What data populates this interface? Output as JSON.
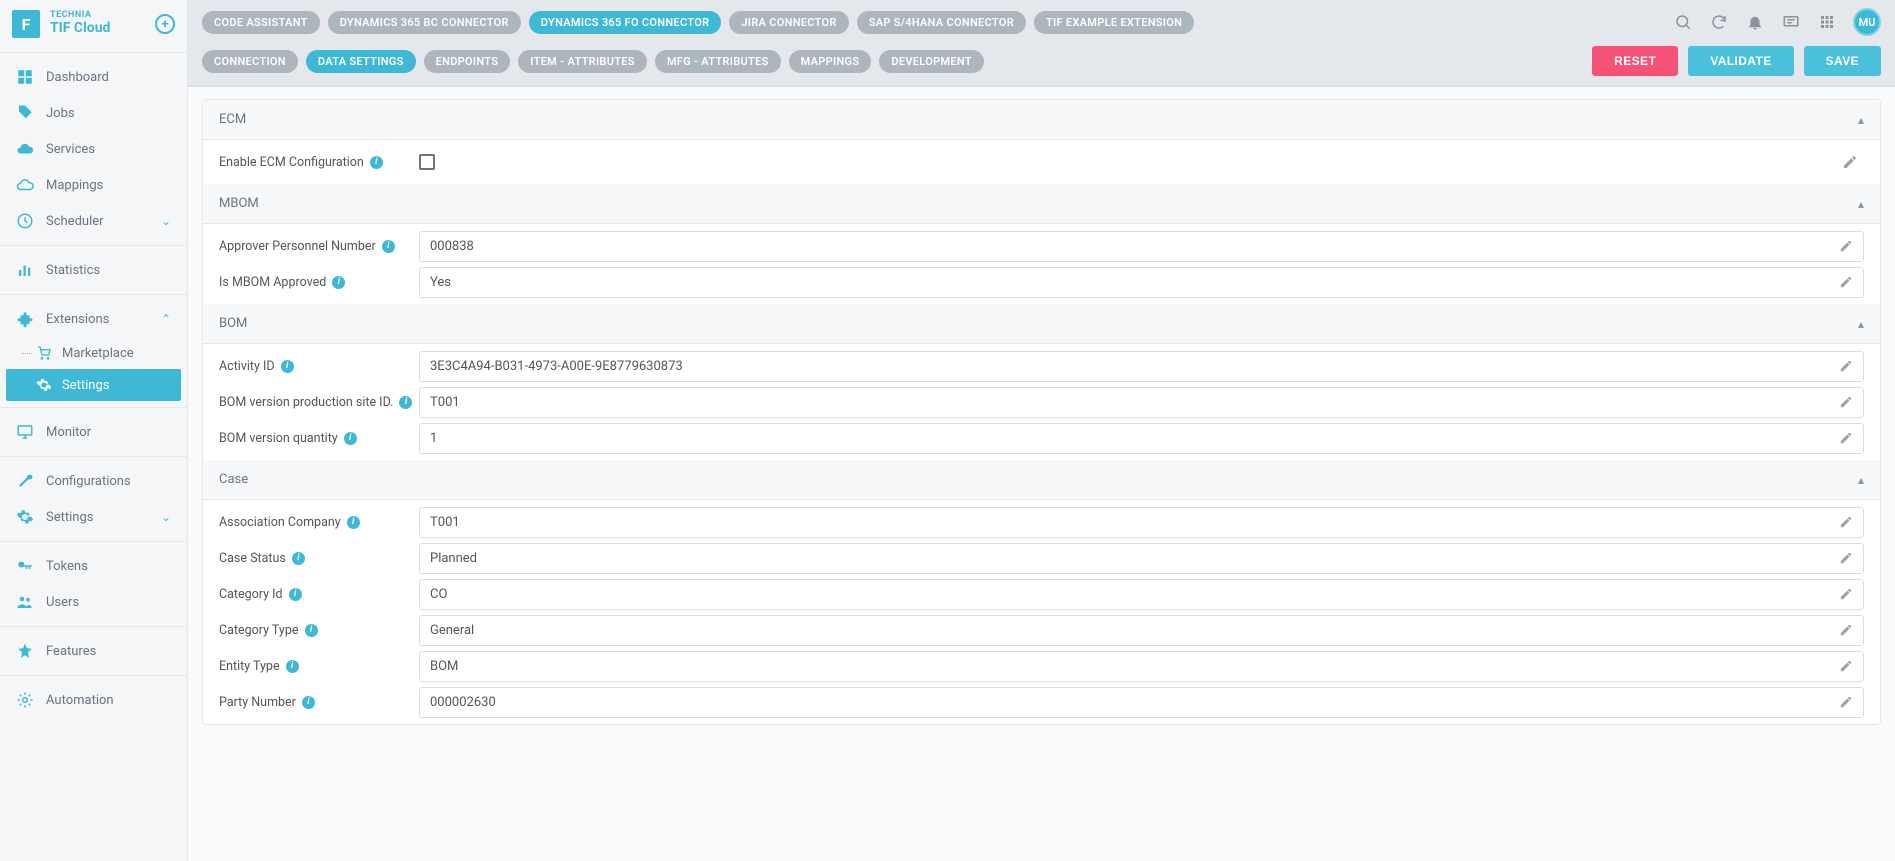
{
  "brand": {
    "company": "TECHNIA",
    "product": "TIF Cloud",
    "logo_letter": "F"
  },
  "user": {
    "initials": "MU"
  },
  "sidebar": {
    "items": [
      {
        "label": "Dashboard"
      },
      {
        "label": "Jobs"
      },
      {
        "label": "Services"
      },
      {
        "label": "Mappings"
      },
      {
        "label": "Scheduler"
      },
      {
        "label": "Statistics"
      },
      {
        "label": "Extensions"
      },
      {
        "label": "Monitor"
      },
      {
        "label": "Configurations"
      },
      {
        "label": "Settings"
      },
      {
        "label": "Tokens"
      },
      {
        "label": "Users"
      },
      {
        "label": "Features"
      },
      {
        "label": "Automation"
      }
    ],
    "ext_children": [
      {
        "label": "Marketplace"
      },
      {
        "label": "Settings"
      }
    ]
  },
  "top_tabs": [
    {
      "label": "CODE ASSISTANT"
    },
    {
      "label": "DYNAMICS 365 BC CONNECTOR"
    },
    {
      "label": "DYNAMICS 365 FO CONNECTOR",
      "active": true
    },
    {
      "label": "JIRA CONNECTOR"
    },
    {
      "label": "SAP S/4HANA CONNECTOR"
    },
    {
      "label": "TIF EXAMPLE EXTENSION"
    }
  ],
  "sub_tabs": [
    {
      "label": "CONNECTION"
    },
    {
      "label": "DATA SETTINGS",
      "active": true
    },
    {
      "label": "ENDPOINTS"
    },
    {
      "label": "ITEM - ATTRIBUTES"
    },
    {
      "label": "MFG - ATTRIBUTES"
    },
    {
      "label": "MAPPINGS"
    },
    {
      "label": "DEVELOPMENT"
    }
  ],
  "buttons": {
    "reset": "RESET",
    "validate": "VALIDATE",
    "save": "SAVE"
  },
  "sections": {
    "ecm": {
      "title": "ECM",
      "fields": [
        {
          "label": "Enable ECM Configuration"
        }
      ]
    },
    "mbom": {
      "title": "MBOM",
      "fields": [
        {
          "label": "Approver Personnel Number",
          "value": "000838"
        },
        {
          "label": "Is MBOM Approved",
          "value": "Yes"
        }
      ]
    },
    "bom": {
      "title": "BOM",
      "fields": [
        {
          "label": "Activity ID",
          "value": "3E3C4A94-B031-4973-A00E-9E8779630873"
        },
        {
          "label": "BOM version production site ID.",
          "value": "T001"
        },
        {
          "label": "BOM version quantity",
          "value": "1"
        }
      ]
    },
    "case": {
      "title": "Case",
      "fields": [
        {
          "label": "Association Company",
          "value": "T001"
        },
        {
          "label": "Case Status",
          "value": "Planned"
        },
        {
          "label": "Category Id",
          "value": "CO"
        },
        {
          "label": "Category Type",
          "value": "General"
        },
        {
          "label": "Entity Type",
          "value": "BOM"
        },
        {
          "label": "Party Number",
          "value": "000002630"
        }
      ]
    }
  }
}
